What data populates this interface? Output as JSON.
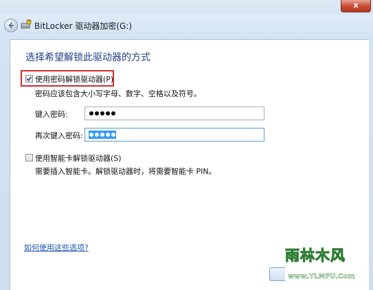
{
  "window": {
    "title": "BitLocker 驱动器加密(G:)",
    "close_label": "x"
  },
  "main": {
    "heading": "选择希望解锁此驱动器的方式",
    "password_option": {
      "label": "使用密码解锁驱动器(P)",
      "checked": true,
      "hint": "密码应该包含大小写字母、数字、空格以及符号。",
      "enter_label": "键入密码:",
      "enter_value_length": 5,
      "reenter_label": "再次键入密码:",
      "reenter_value_length": 5
    },
    "smartcard_option": {
      "label": "使用智能卡解锁驱动器(S)",
      "checked": false,
      "hint": "需要插入智能卡。解锁驱动器时，将需要智能卡 PIN。"
    },
    "help_link": "如何使用这些选项?"
  },
  "watermark": {
    "name": "雨林木风",
    "url": "www.YLMFU.Com"
  },
  "colors": {
    "highlight": "#d52a2a",
    "heading": "#1f3f86",
    "link": "#1a55b3",
    "selection": "#3399ff"
  }
}
